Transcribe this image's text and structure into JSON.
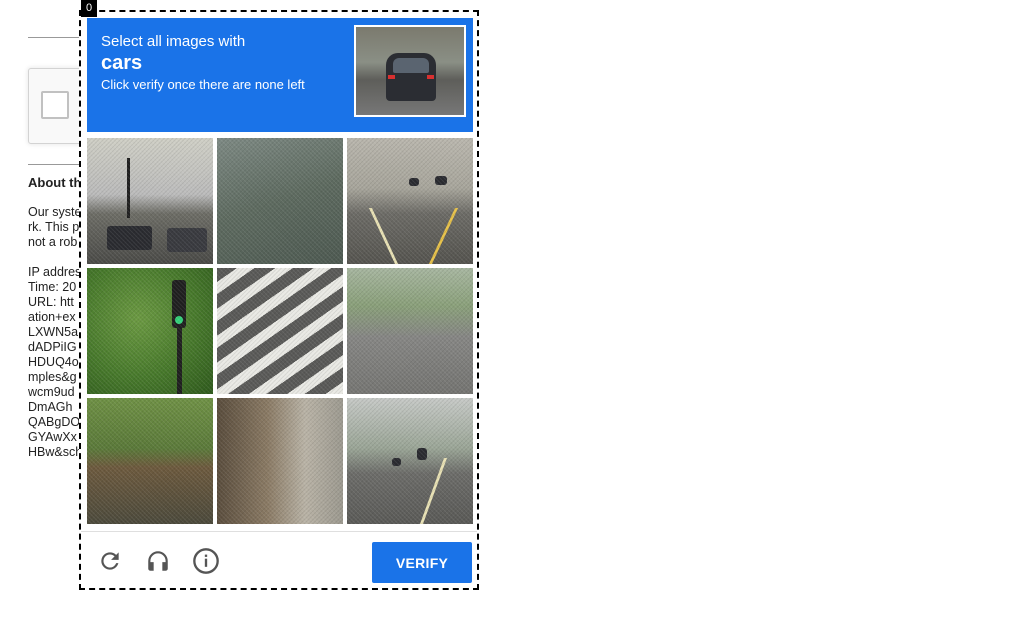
{
  "background_page": {
    "about_title": "About th",
    "lines": [
      "Our syste",
      "rk. This p",
      "not a rob",
      "",
      "IP addres",
      "Time: 20",
      "URL: htt",
      "ation+ex",
      "LXWN5a",
      "dADPiIG",
      "HDUQ4o",
      "mples&g",
      "wcm9ud",
      "DmAGh",
      "QABgDO",
      "GYAwXx",
      "HBw&sch"
    ]
  },
  "frame_index": "0",
  "challenge": {
    "prompt_line1": "Select all images with",
    "target": "cars",
    "prompt_line3": "Click verify once there are none left",
    "accent_color": "#1a73e8",
    "tiles": [
      {
        "name": "tile-1"
      },
      {
        "name": "tile-2"
      },
      {
        "name": "tile-3"
      },
      {
        "name": "tile-4"
      },
      {
        "name": "tile-5"
      },
      {
        "name": "tile-6"
      },
      {
        "name": "tile-7"
      },
      {
        "name": "tile-8"
      },
      {
        "name": "tile-9"
      }
    ]
  },
  "footer": {
    "icons": [
      "reload-icon",
      "headphones-icon",
      "info-icon"
    ],
    "verify_label": "VERIFY"
  }
}
